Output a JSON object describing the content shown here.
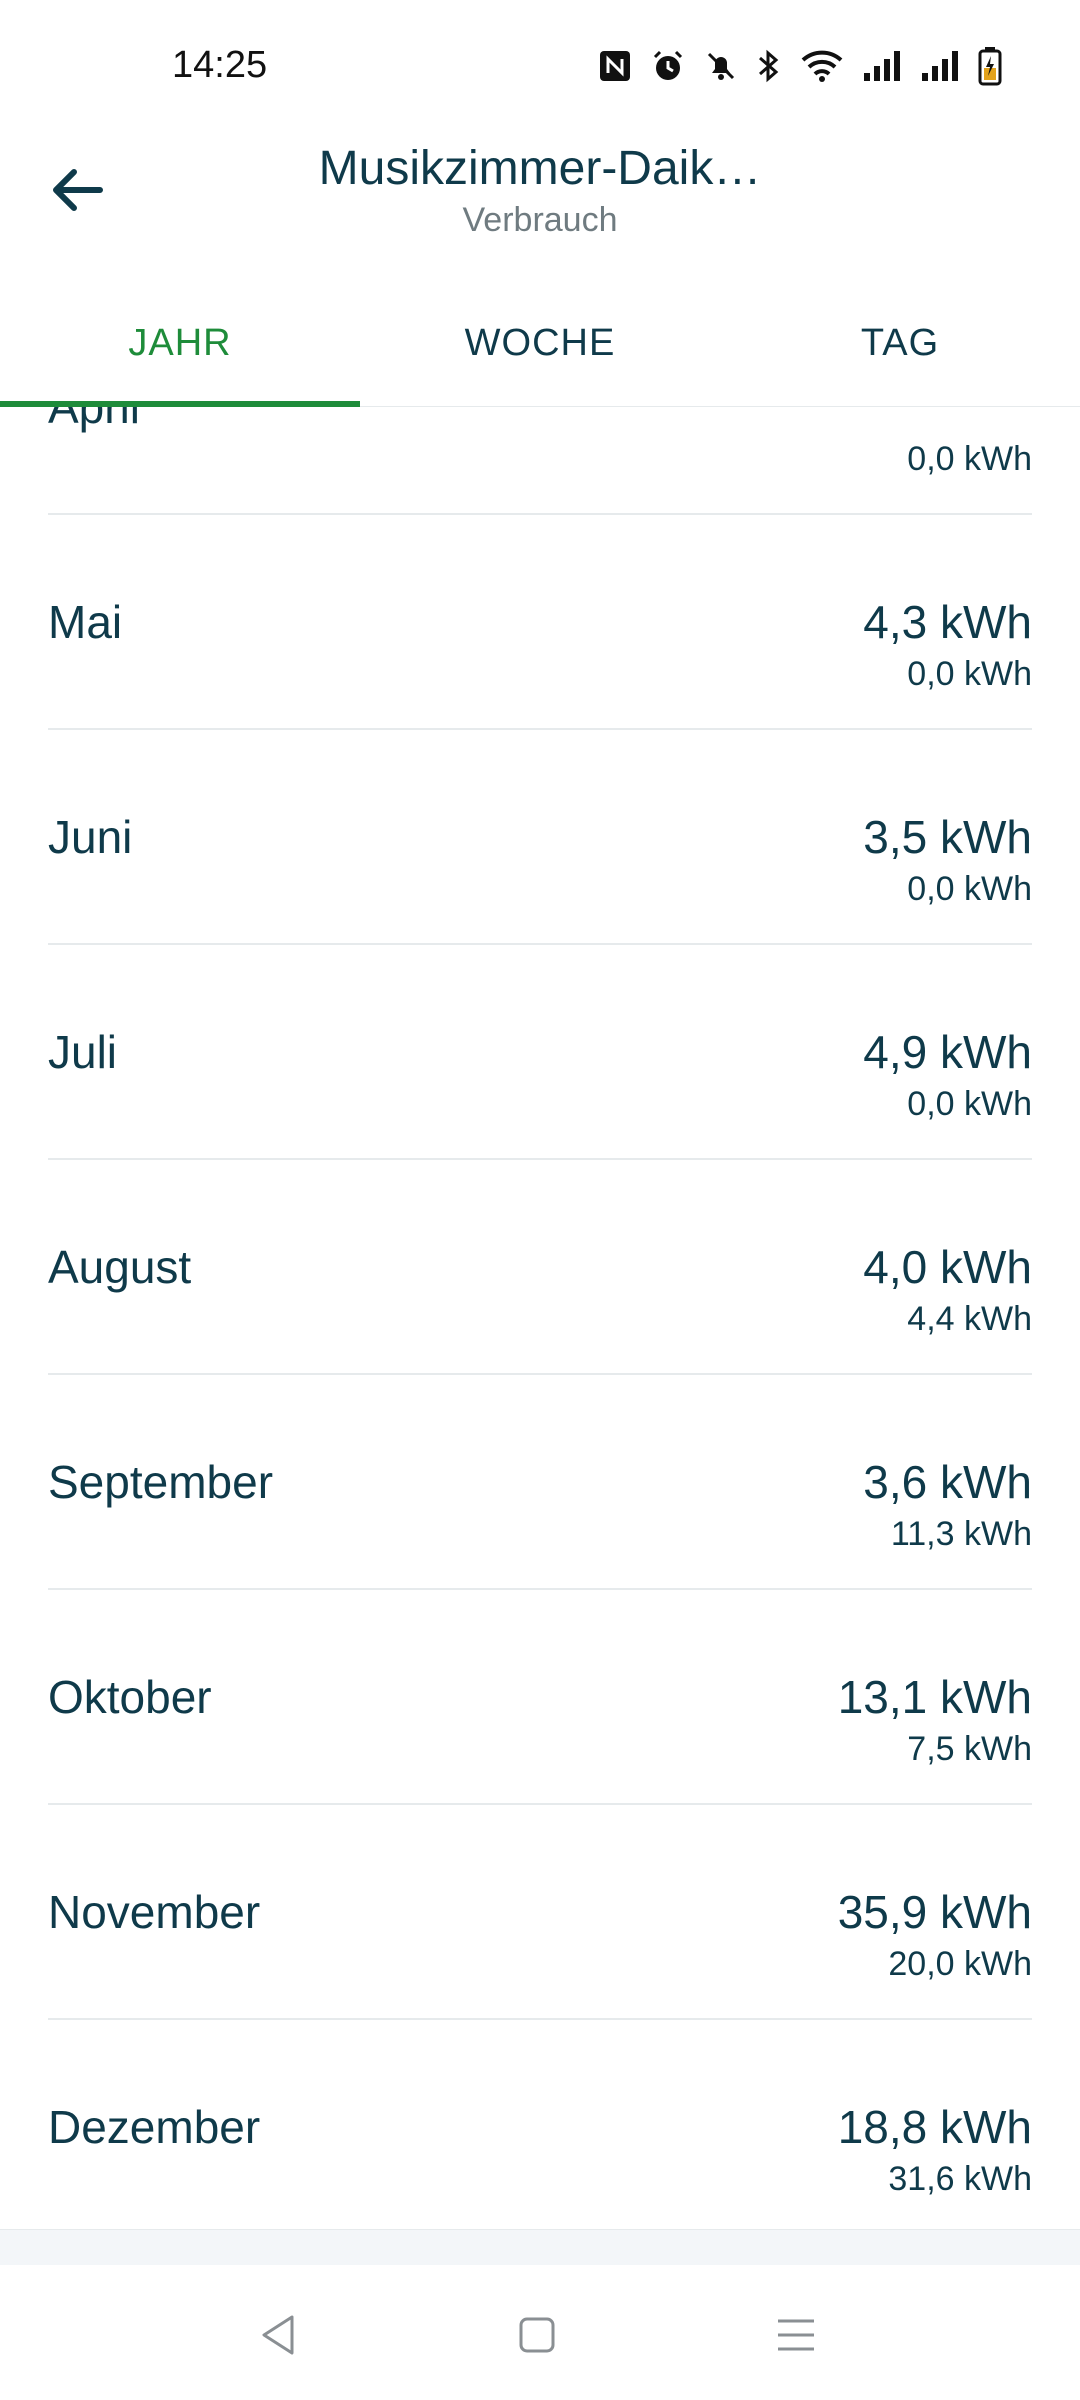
{
  "status_bar": {
    "time": "14:25",
    "icons": [
      "nfc-icon",
      "alarm-icon",
      "mute-icon",
      "bluetooth-icon",
      "wifi-icon",
      "signal-icon",
      "signal-icon",
      "battery-charging-icon"
    ]
  },
  "app_bar": {
    "title": "Musikzimmer-Daik…",
    "subtitle": "Verbrauch",
    "back_icon": "arrow-left-icon"
  },
  "tabs": [
    {
      "label": "JAHR",
      "active": true
    },
    {
      "label": "WOCHE",
      "active": false
    },
    {
      "label": "TAG",
      "active": false
    }
  ],
  "months": [
    {
      "label": "April",
      "value": "",
      "prev": "0,0 kWh"
    },
    {
      "label": "Mai",
      "value": "4,3 kWh",
      "prev": "0,0 kWh"
    },
    {
      "label": "Juni",
      "value": "3,5 kWh",
      "prev": "0,0 kWh"
    },
    {
      "label": "Juli",
      "value": "4,9 kWh",
      "prev": "0,0 kWh"
    },
    {
      "label": "August",
      "value": "4,0 kWh",
      "prev": "4,4 kWh"
    },
    {
      "label": "September",
      "value": "3,6 kWh",
      "prev": "11,3 kWh"
    },
    {
      "label": "Oktober",
      "value": "13,1 kWh",
      "prev": "7,5 kWh"
    },
    {
      "label": "November",
      "value": "35,9 kWh",
      "prev": "20,0 kWh"
    },
    {
      "label": "Dezember",
      "value": "18,8 kWh",
      "prev": "31,6 kWh"
    }
  ],
  "colors": {
    "accent": "#1e8c3a",
    "text": "#0f3a4a",
    "muted": "#6f7b80",
    "divider": "#e6eaec"
  },
  "nav_bar": {
    "icons": [
      "back-triangle-icon",
      "home-square-icon",
      "menu-lines-icon"
    ]
  }
}
